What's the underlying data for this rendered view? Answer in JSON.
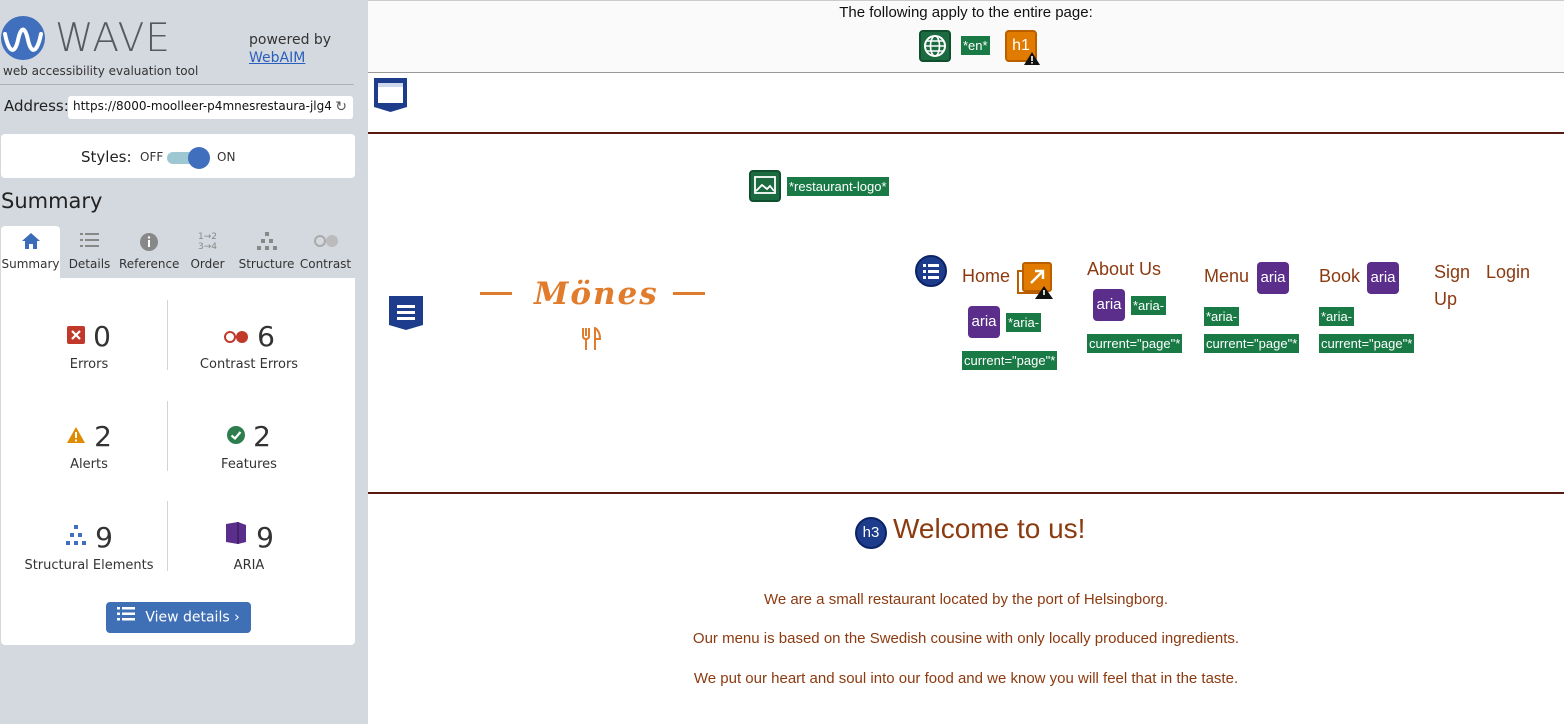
{
  "panel": {
    "logo_text": "WAVE",
    "logo_sub": "web accessibility evaluation tool",
    "powered_by": "powered by",
    "powered_link": "WebAIM",
    "address_label": "Address:",
    "address_value": "https://8000-moolleer-p4mnesrestaura-jlg4",
    "styles_label": "Styles:",
    "styles_off": "OFF",
    "styles_on": "ON",
    "summary_heading": "Summary",
    "tabs": [
      {
        "label": "Summary",
        "icon": "home-icon"
      },
      {
        "label": "Details",
        "icon": "list-icon"
      },
      {
        "label": "Reference",
        "icon": "info-icon"
      },
      {
        "label": "Order",
        "icon": "order-icon"
      },
      {
        "label": "Structure",
        "icon": "structure-icon"
      },
      {
        "label": "Contrast",
        "icon": "contrast-icon"
      }
    ],
    "stats": {
      "errors": {
        "count": "0",
        "label": "Errors"
      },
      "contrast": {
        "count": "6",
        "label": "Contrast Errors"
      },
      "alerts": {
        "count": "2",
        "label": "Alerts"
      },
      "features": {
        "count": "2",
        "label": "Features"
      },
      "structural": {
        "count": "9",
        "label": "Structural Elements"
      },
      "aria": {
        "count": "9",
        "label": "ARIA"
      }
    },
    "view_details": "View details ›"
  },
  "page": {
    "banner_text": "The following apply to the entire page:",
    "lang_tag": "*en*",
    "h1_icon": "h1",
    "logo_alt_tag": "*restaurant-logo*",
    "brand": "Mönes",
    "nav": {
      "home": "Home",
      "about": "About Us",
      "menu": "Menu",
      "book": "Book",
      "signup_1": "Sign",
      "signup_2": "Up",
      "login": "Login"
    },
    "aria_icon": "aria",
    "aria_tag_1": "*aria-",
    "aria_tag_2": "current=\"page\"*",
    "h3_icon": "h3",
    "welcome": "Welcome to us!",
    "paragraphs": [
      "We are a small restaurant located by the port of Helsingborg.",
      "Our menu is based on the Swedish cousine with only locally produced ingredients.",
      "We put our heart and soul into our food and we know you will feel that in the taste."
    ]
  },
  "colors": {
    "accent_blue": "#3f6fb5",
    "wave_green": "#1a7a46",
    "brand_orange": "#e07c2b",
    "text_brown": "#8c3a10",
    "aria_purple": "#5a2e8a"
  }
}
